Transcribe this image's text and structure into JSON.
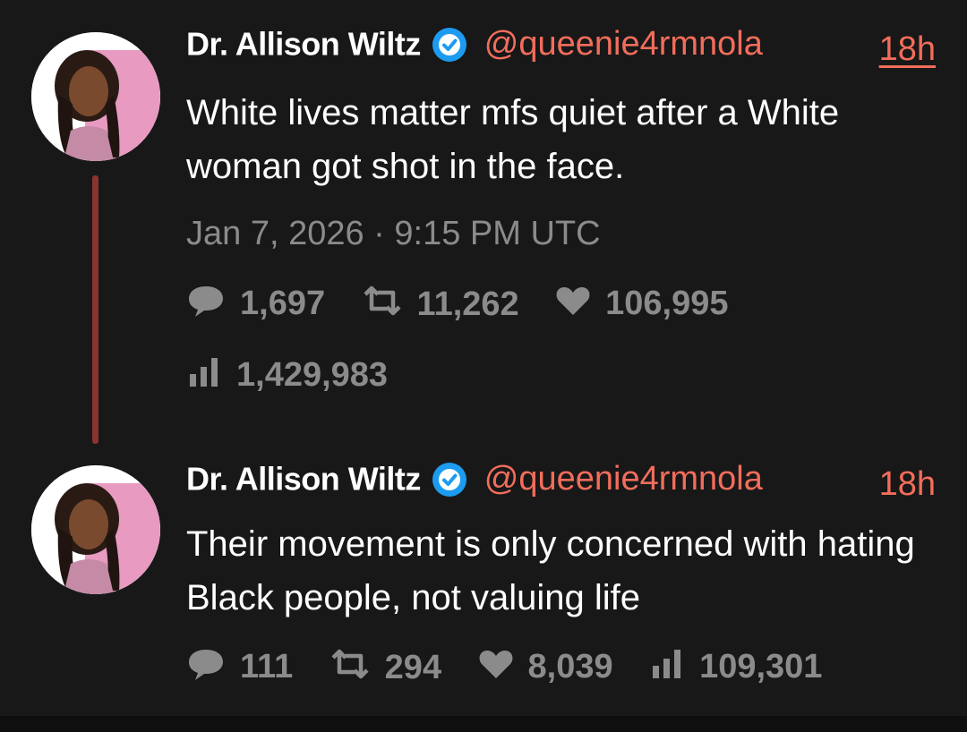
{
  "tweets": [
    {
      "author": "Dr. Allison Wiltz",
      "handle": "@queenie4rmnola",
      "time": "18h",
      "text": "White lives matter mfs quiet after a White woman got shot in the face.",
      "date": "Jan 7, 2026 · 9:15 PM UTC",
      "replies": "1,697",
      "retweets": "11,262",
      "likes": "106,995",
      "views": "1,429,983"
    },
    {
      "author": "Dr. Allison Wiltz",
      "handle": "@queenie4rmnola",
      "time": "18h",
      "text": "Their movement is only concerned with hating Black people, not valuing life",
      "replies": "111",
      "retweets": "294",
      "likes": "8,039",
      "views": "109,301"
    }
  ],
  "colors": {
    "background": "#181818",
    "accent": "#f26d5b",
    "muted": "#8b8b8b",
    "thread_line": "#8a3430",
    "verified": "#1d9bf0"
  },
  "icons": [
    "comment-icon",
    "retweet-icon",
    "heart-icon",
    "views-icon",
    "verified-badge-icon"
  ]
}
